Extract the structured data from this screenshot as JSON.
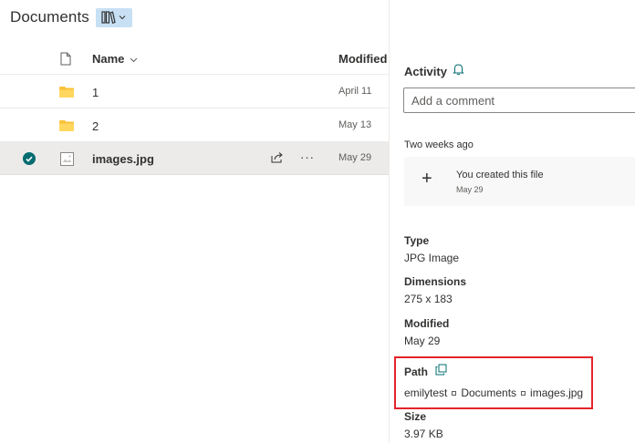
{
  "library": {
    "title": "Documents",
    "view_icon": "library-view-icon"
  },
  "columns": {
    "name": "Name",
    "modified": "Modified"
  },
  "rows": [
    {
      "name": "1",
      "modified": "April 11",
      "type": "folder"
    },
    {
      "name": "2",
      "modified": "May 13",
      "type": "folder"
    },
    {
      "name": "images.jpg",
      "modified": "May 29",
      "type": "image",
      "selected": true,
      "more": "···"
    }
  ],
  "details": {
    "activity_title": "Activity",
    "comment_placeholder": "Add a comment",
    "activity_group": "Two weeks ago",
    "activity_item": {
      "plus": "+",
      "text": "You created this file",
      "date": "May 29"
    },
    "properties": {
      "type_label": "Type",
      "type_value": "JPG Image",
      "dimensions_label": "Dimensions",
      "dimensions_value": "275 x 183",
      "modified_label": "Modified",
      "modified_value": "May 29",
      "path_label": "Path",
      "path_parts": [
        "emilytest",
        "Documents",
        "images.jpg"
      ],
      "size_label": "Size",
      "size_value": "3.97 KB"
    }
  },
  "colors": {
    "accent_teal": "#036c70",
    "folder_yellow": "#f8c239",
    "view_button_bg": "#c7e0f4",
    "highlight_red": "#e3242b",
    "selected_row": "#edebe9"
  }
}
